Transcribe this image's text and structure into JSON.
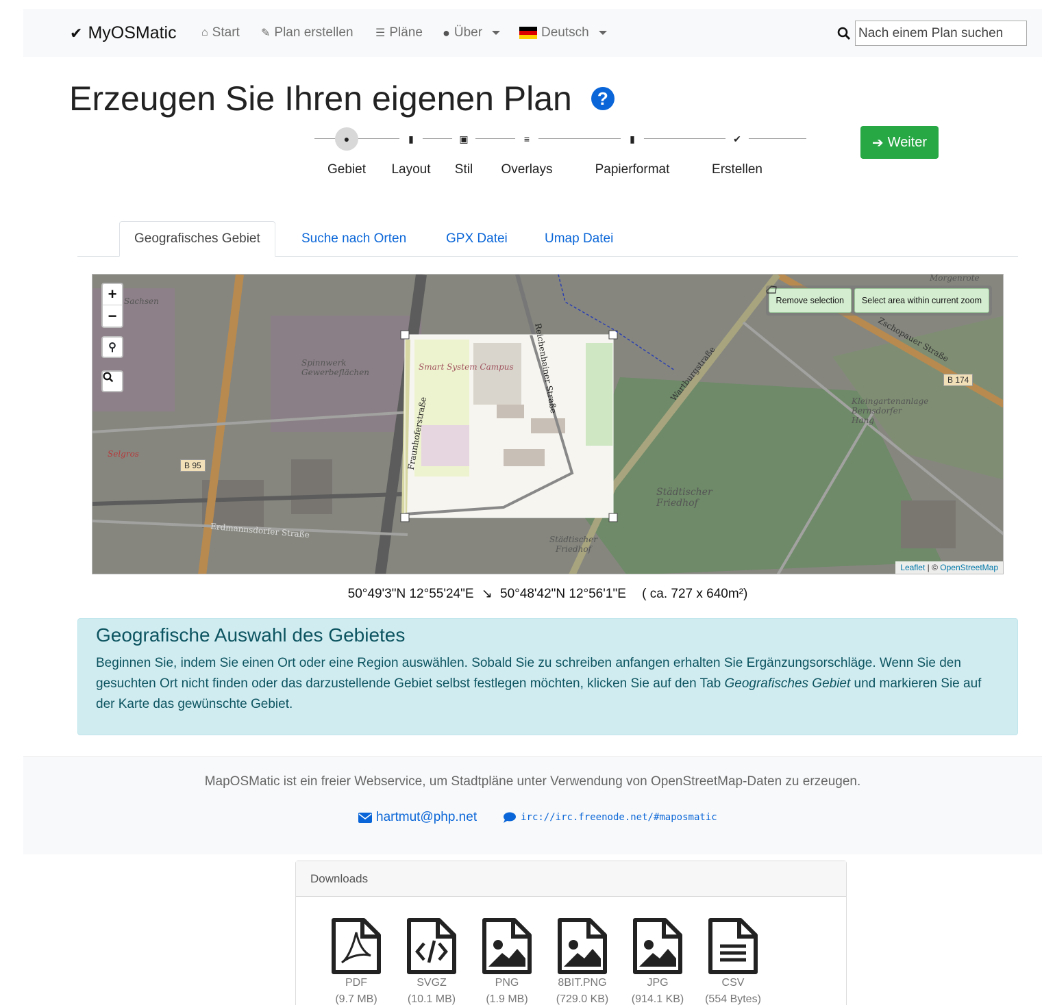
{
  "navbar": {
    "brand": "MyOSMatic",
    "items": [
      {
        "label": "Start",
        "icon": "home-icon"
      },
      {
        "label": "Plan erstellen",
        "icon": "edit-icon"
      },
      {
        "label": "Pläne",
        "icon": "list-icon"
      },
      {
        "label": "Über",
        "icon": "comment-icon"
      },
      {
        "label": "Deutsch",
        "icon": "german-flag-icon"
      }
    ],
    "search_placeholder": "Nach einem Plan suchen"
  },
  "title": "Erzeugen Sie Ihren eigenen Plan",
  "steps": [
    {
      "label": "Gebiet",
      "icon": "globe-icon",
      "active": true
    },
    {
      "label": "Layout",
      "icon": "file-icon"
    },
    {
      "label": "Stil",
      "icon": "image-icon"
    },
    {
      "label": "Overlays",
      "icon": "bars-icon"
    },
    {
      "label": "Papierformat",
      "icon": "file-icon"
    },
    {
      "label": "Erstellen",
      "icon": "check-icon"
    }
  ],
  "next_button": "Weiter",
  "tabs": [
    "Geografisches Gebiet",
    "Suche nach Orten",
    "GPX Datei",
    "Umap Datei"
  ],
  "map": {
    "zoom_in": "+",
    "zoom_out": "−",
    "remove_selection": "Remove selection",
    "select_area": "Select area within current zoom",
    "attribution_leaflet": "Leaflet",
    "attribution_sep": " | © ",
    "attribution_osm": "OpenStreetMap",
    "labels": {
      "smart_system_campus": "Smart System Campus",
      "spinnwerk": "Spinnwerk Gewerbeflächen",
      "friedhof": "Städtischer Friedhof",
      "friedhof_small": "Städtischer Friedhof",
      "kleingarten": "Kleingartenanlage Bernsdorfer Hang",
      "selgros": "Selgros",
      "b95": "B 95",
      "b174": "B 174",
      "morgenrote": "Morgenrote",
      "sachsen": "Sachsen",
      "wartburgstrasse": "Wartburgstraße",
      "zschopauer": "Zschopauer Straße",
      "fraunhofer": "Fraunhoferstraße",
      "reichenhainer": "Reichenhainer Straße",
      "erdmannsdorfer": "Erdmannsdorfer Straße"
    }
  },
  "coords": {
    "from": "50°49'3\"N 12°55'24\"E",
    "arrow": "↘",
    "to": "50°48'42\"N 12°56'1\"E",
    "size": "( ca. 727 x 640m²)"
  },
  "info": {
    "heading": "Geografische Auswahl des Gebietes",
    "text_before": "Beginnen Sie, indem Sie einen Ort oder eine Region auswählen. Sobald Sie zu schreiben anfangen erhalten Sie Ergänzungsorschläge. Wenn Sie den gesuchten Ort nicht finden oder das darzustellende Gebiet selbst festlegen möchten, klicken Sie auf den Tab ",
    "text_em": "Geografisches Gebiet",
    "text_after": " und markieren Sie auf der Karte das gewünschte Gebiet."
  },
  "footer": {
    "text": "MapOSMatic ist ein freier Webservice, um Stadtpläne unter Verwendung von OpenStreetMap-Daten zu erzeugen.",
    "email": "hartmut@php.net",
    "irc": "irc://irc.freenode.net/#maposmatic"
  },
  "downloads": {
    "heading": "Downloads",
    "items": [
      {
        "format": "PDF",
        "size": "(9.7 MB)",
        "icon": "pdf-file-icon"
      },
      {
        "format": "SVGZ",
        "size": "(10.1 MB)",
        "icon": "code-file-icon"
      },
      {
        "format": "PNG",
        "size": "(1.9 MB)",
        "icon": "image-file-icon"
      },
      {
        "format": "8BIT.PNG",
        "size": "(729.0 KB)",
        "icon": "image-file-icon"
      },
      {
        "format": "JPG",
        "size": "(914.1 KB)",
        "icon": "image-file-icon"
      },
      {
        "format": "CSV",
        "size": "(554 Bytes)",
        "icon": "text-file-icon"
      }
    ]
  },
  "colors": {
    "primary": "#0a66d8",
    "success": "#28a745",
    "info_bg": "#d1ecf1",
    "info_text": "#0c5460"
  }
}
